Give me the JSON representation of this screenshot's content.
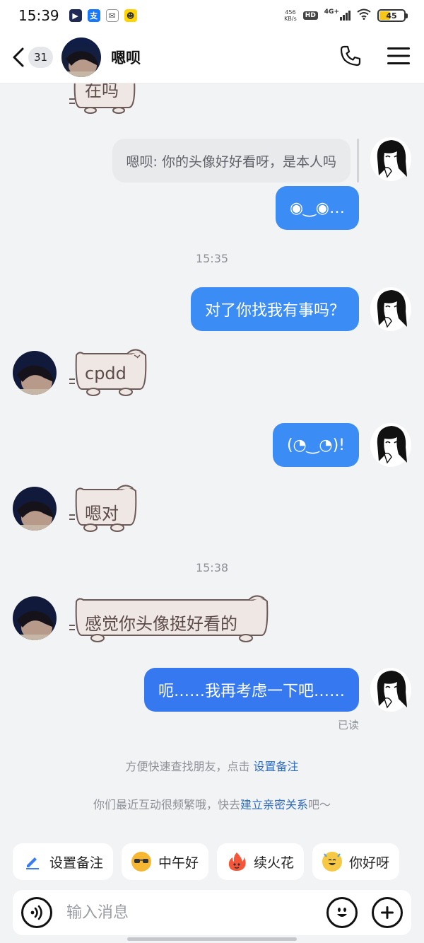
{
  "status_bar": {
    "time": "15:39",
    "net_speed_value": "456",
    "net_speed_unit": "KB/s",
    "hd": "HD",
    "network": "4G+",
    "battery": "45",
    "battery_level": 0.45
  },
  "header": {
    "unread_count": "31",
    "contact_name": "嗯呗",
    "icons": [
      "back-chevron",
      "phone",
      "menu"
    ]
  },
  "messages": {
    "partial_sticker": "在吗",
    "quote": "嗯呗: 你的头像好好看呀，是本人吗",
    "msg1": "◉‿◉…",
    "time1": "15:35",
    "msg2": "对了你找我有事吗？",
    "sticker1": "cpdd",
    "msg3": "(◔‿◔)!",
    "sticker2": "嗯对",
    "time2": "15:38",
    "sticker3": "感觉你头像挺好看的",
    "msg4": "呃……我再考虑一下吧……",
    "read_status": "已读"
  },
  "system_tips": {
    "tip1_prefix": "方便快速查找朋友，点击 ",
    "tip1_link": "设置备注",
    "tip2_prefix": "你们最近互动很频繁哦，快去",
    "tip2_link": "建立亲密关系",
    "tip2_suffix": "吧～"
  },
  "quick_replies": [
    {
      "label": "设置备注",
      "icon": "pencil-icon"
    },
    {
      "label": "中午好",
      "icon": "sunglasses-emoji"
    },
    {
      "label": "续火花",
      "icon": "fire-emoji"
    },
    {
      "label": "你好呀",
      "icon": "party-emoji"
    }
  ],
  "input": {
    "placeholder": "输入消息"
  },
  "colors": {
    "accent": "#3b8cf5",
    "link": "#2d6bbf",
    "background": "#f2f3f5"
  }
}
